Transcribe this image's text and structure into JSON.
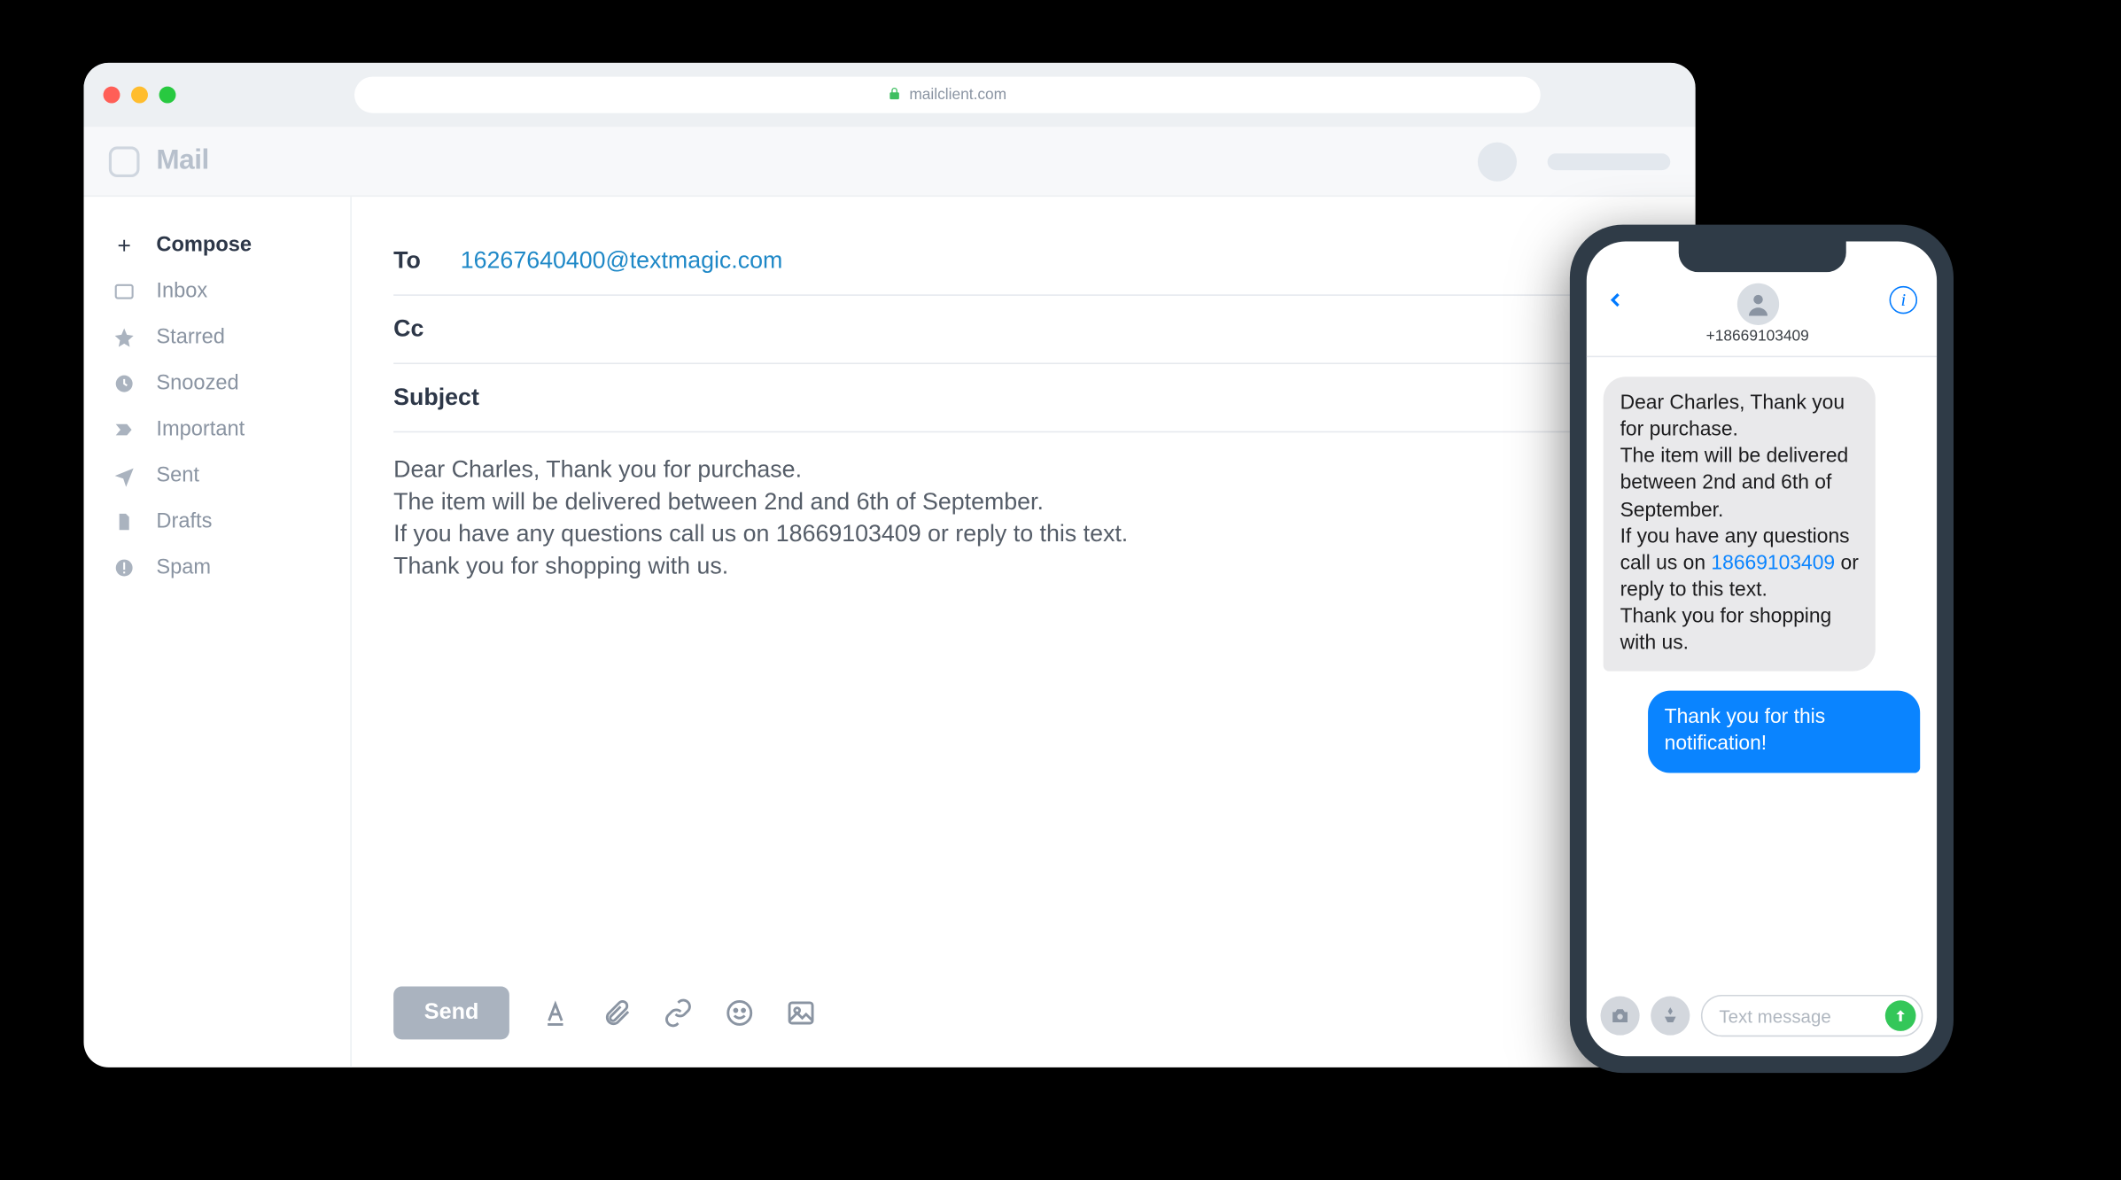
{
  "browser": {
    "url_host": "mailclient.com"
  },
  "mail": {
    "app_title": "Mail",
    "sidebar": {
      "items": [
        {
          "label": "Compose",
          "icon": "plus",
          "active": true
        },
        {
          "label": "Inbox",
          "icon": "inbox",
          "active": false
        },
        {
          "label": "Starred",
          "icon": "star",
          "active": false
        },
        {
          "label": "Snoozed",
          "icon": "clock",
          "active": false
        },
        {
          "label": "Important",
          "icon": "tag",
          "active": false
        },
        {
          "label": "Sent",
          "icon": "send",
          "active": false
        },
        {
          "label": "Drafts",
          "icon": "file",
          "active": false
        },
        {
          "label": "Spam",
          "icon": "alert",
          "active": false
        }
      ]
    },
    "compose": {
      "to_label": "To",
      "to_value": "16267640400@textmagic.com",
      "cc_label": "Cc",
      "subject_label": "Subject",
      "body": "Dear Charles, Thank you for purchase.\nThe item will be delivered between 2nd and 6th of September.\nIf you have any questions call us on 18669103409 or reply to this text.\nThank you for shopping with us.",
      "send_label": "Send"
    }
  },
  "phone": {
    "contact_number": "+18669103409",
    "messages": {
      "incoming": {
        "pre": "Dear Charles, Thank you for purchase.\nThe item will be delivered between 2nd and 6th of September.\nIf you have any questions call us on ",
        "link": "18669103409",
        "post": " or reply to this text.\nThank you for shopping with us."
      },
      "outgoing": "Thank you for this notification!"
    },
    "input_placeholder": "Text message"
  }
}
